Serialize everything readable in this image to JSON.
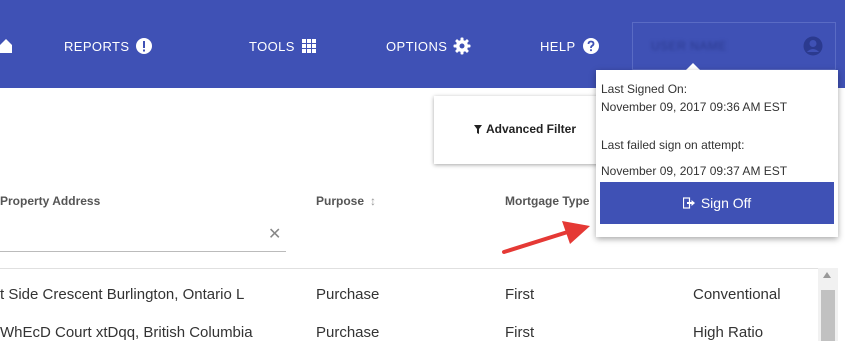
{
  "nav": {
    "home_icon": "home-icon",
    "reports": "REPORTS",
    "tools": "TOOLS",
    "options": "OPTIONS",
    "help": "HELP",
    "user_name": "USER NAME",
    "brand_color": "#3f51b5"
  },
  "toolbar": {
    "advanced_filter": "Advanced Filter"
  },
  "table": {
    "headers": {
      "property_address": "Property Address",
      "purpose": "Purpose",
      "mortgage_type": "Mortgage Type"
    },
    "rows": [
      {
        "address": "t Side Crescent Burlington, Ontario L",
        "purpose": "Purchase",
        "mortgage": "First",
        "product": "Conventional"
      },
      {
        "address": "WhEcD Court xtDqq, British Columbia",
        "purpose": "Purchase",
        "mortgage": "First",
        "product": "High Ratio"
      }
    ]
  },
  "user_menu": {
    "last_signed_label": "Last Signed On:",
    "last_signed_value": "November 09, 2017 09:36 AM EST",
    "last_failed_label": "Last failed sign on attempt:",
    "last_failed_value": "November 09, 2017 09:37 AM EST",
    "sign_off": "Sign Off"
  },
  "annotation_color": "#e53935"
}
